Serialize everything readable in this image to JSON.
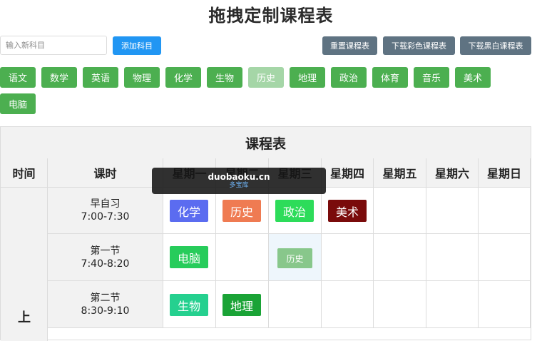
{
  "page_title": "拖拽定制课程表",
  "toolbar": {
    "subject_placeholder": "输入新科目",
    "add_label": "添加科目",
    "reset_label": "重置课程表",
    "download_color_label": "下载彩色课程表",
    "download_bw_label": "下载黑白课程表"
  },
  "subjects": [
    "语文",
    "数学",
    "英语",
    "物理",
    "化学",
    "生物",
    "历史",
    "地理",
    "政治",
    "体育",
    "音乐",
    "美术",
    "电脑"
  ],
  "schedule": {
    "title": "课程表",
    "headers": [
      "时间",
      "课时",
      "星期一",
      "星期二",
      "星期三",
      "星期四",
      "星期五",
      "星期六",
      "星期日"
    ],
    "period_label": "上",
    "rows": [
      {
        "name": "早自习",
        "time": "7:00-7:30",
        "cells": {
          "mon": "化学",
          "tue": "历史",
          "wed": "政治",
          "thu": "美术"
        }
      },
      {
        "name": "第一节",
        "time": "7:40-8:20",
        "cells": {
          "mon": "电脑",
          "wed_drag": "历史"
        }
      },
      {
        "name": "第二节",
        "time": "8:30-9:10",
        "cells": {
          "mon": "生物",
          "tue": "地理"
        }
      }
    ]
  },
  "colors": {
    "add_button": "#2196f3",
    "dark_button": "#5f7382",
    "subject_chip": "#4caf50",
    "chemistry": "#5b6cf0",
    "history": "#ef7b52",
    "politics": "#2ddc5a",
    "art": "#7a0b0b",
    "computer": "#27cc5b",
    "biology": "#25d08f",
    "geography": "#1aa336"
  },
  "watermark": {
    "main": "duobaoku.cn",
    "sub": "多宝库"
  }
}
